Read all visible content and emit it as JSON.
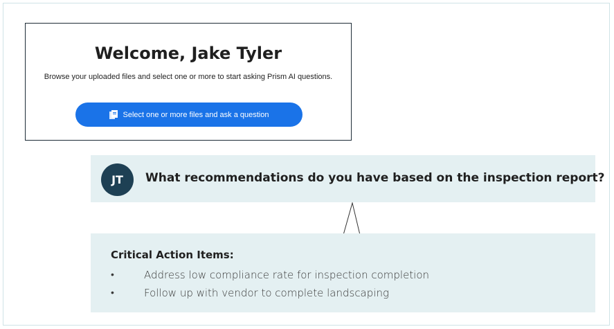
{
  "welcome": {
    "title": "Welcome, Jake Tyler",
    "subtitle": "Browse your uploaded files and select one or more to start asking Prism AI questions.",
    "button_label": "Select one or more files and ask a question",
    "button_icon": "file-copy-icon",
    "button_color": "#1a73e8"
  },
  "question": {
    "avatar_initials": "JT",
    "avatar_color": "#1e4054",
    "text": "What recommendations do you have based on the inspection report?"
  },
  "answer": {
    "heading": "Critical Action Items:",
    "items": [
      {
        "bullet": "•",
        "text": "Address low compliance rate for inspection completion"
      },
      {
        "bullet": "•",
        "text": "Follow up with vendor to complete landscaping"
      }
    ]
  },
  "colors": {
    "panel_background": "#e4f0f2",
    "frame_border": "#cfe3e6"
  }
}
